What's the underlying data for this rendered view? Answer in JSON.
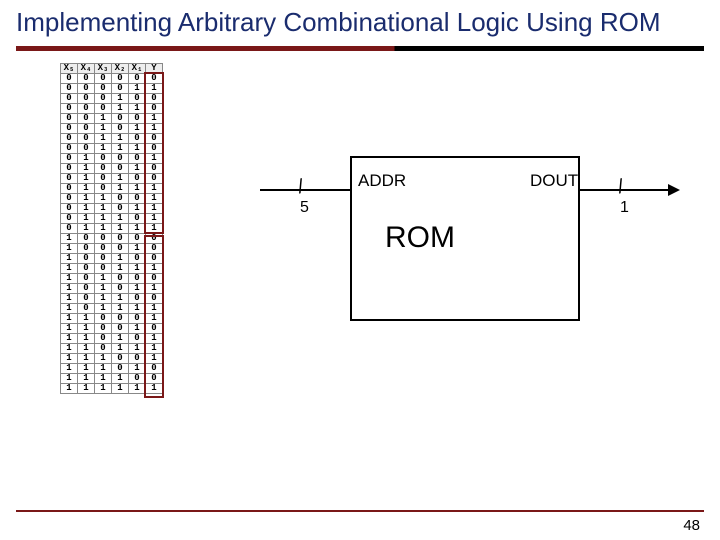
{
  "title": "Implementing Arbitrary Combinational Logic Using ROM",
  "rom": {
    "label": "ROM",
    "addr_label": "ADDR",
    "dout_label": "DOUT",
    "addr_width": "5",
    "dout_width": "1"
  },
  "table": {
    "headers": [
      "X₅",
      "X₄",
      "X₃",
      "X₂",
      "X₁",
      "Y"
    ],
    "rows": [
      [
        "0",
        "0",
        "0",
        "0",
        "0",
        "0"
      ],
      [
        "0",
        "0",
        "0",
        "0",
        "1",
        "1"
      ],
      [
        "0",
        "0",
        "0",
        "1",
        "0",
        "0"
      ],
      [
        "0",
        "0",
        "0",
        "1",
        "1",
        "0"
      ],
      [
        "0",
        "0",
        "1",
        "0",
        "0",
        "1"
      ],
      [
        "0",
        "0",
        "1",
        "0",
        "1",
        "1"
      ],
      [
        "0",
        "0",
        "1",
        "1",
        "0",
        "0"
      ],
      [
        "0",
        "0",
        "1",
        "1",
        "1",
        "0"
      ],
      [
        "0",
        "1",
        "0",
        "0",
        "0",
        "1"
      ],
      [
        "0",
        "1",
        "0",
        "0",
        "1",
        "0"
      ],
      [
        "0",
        "1",
        "0",
        "1",
        "0",
        "0"
      ],
      [
        "0",
        "1",
        "0",
        "1",
        "1",
        "1"
      ],
      [
        "0",
        "1",
        "1",
        "0",
        "0",
        "1"
      ],
      [
        "0",
        "1",
        "1",
        "0",
        "1",
        "1"
      ],
      [
        "0",
        "1",
        "1",
        "1",
        "0",
        "1"
      ],
      [
        "0",
        "1",
        "1",
        "1",
        "1",
        "1"
      ],
      [
        "1",
        "0",
        "0",
        "0",
        "0",
        "0"
      ],
      [
        "1",
        "0",
        "0",
        "0",
        "1",
        "0"
      ],
      [
        "1",
        "0",
        "0",
        "1",
        "0",
        "0"
      ],
      [
        "1",
        "0",
        "0",
        "1",
        "1",
        "1"
      ],
      [
        "1",
        "0",
        "1",
        "0",
        "0",
        "0"
      ],
      [
        "1",
        "0",
        "1",
        "0",
        "1",
        "1"
      ],
      [
        "1",
        "0",
        "1",
        "1",
        "0",
        "0"
      ],
      [
        "1",
        "0",
        "1",
        "1",
        "1",
        "1"
      ],
      [
        "1",
        "1",
        "0",
        "0",
        "0",
        "1"
      ],
      [
        "1",
        "1",
        "0",
        "0",
        "1",
        "0"
      ],
      [
        "1",
        "1",
        "0",
        "1",
        "0",
        "1"
      ],
      [
        "1",
        "1",
        "0",
        "1",
        "1",
        "1"
      ],
      [
        "1",
        "1",
        "1",
        "0",
        "0",
        "1"
      ],
      [
        "1",
        "1",
        "1",
        "0",
        "1",
        "0"
      ],
      [
        "1",
        "1",
        "1",
        "1",
        "0",
        "0"
      ],
      [
        "1",
        "1",
        "1",
        "1",
        "1",
        "1"
      ]
    ]
  },
  "page_number": "48"
}
